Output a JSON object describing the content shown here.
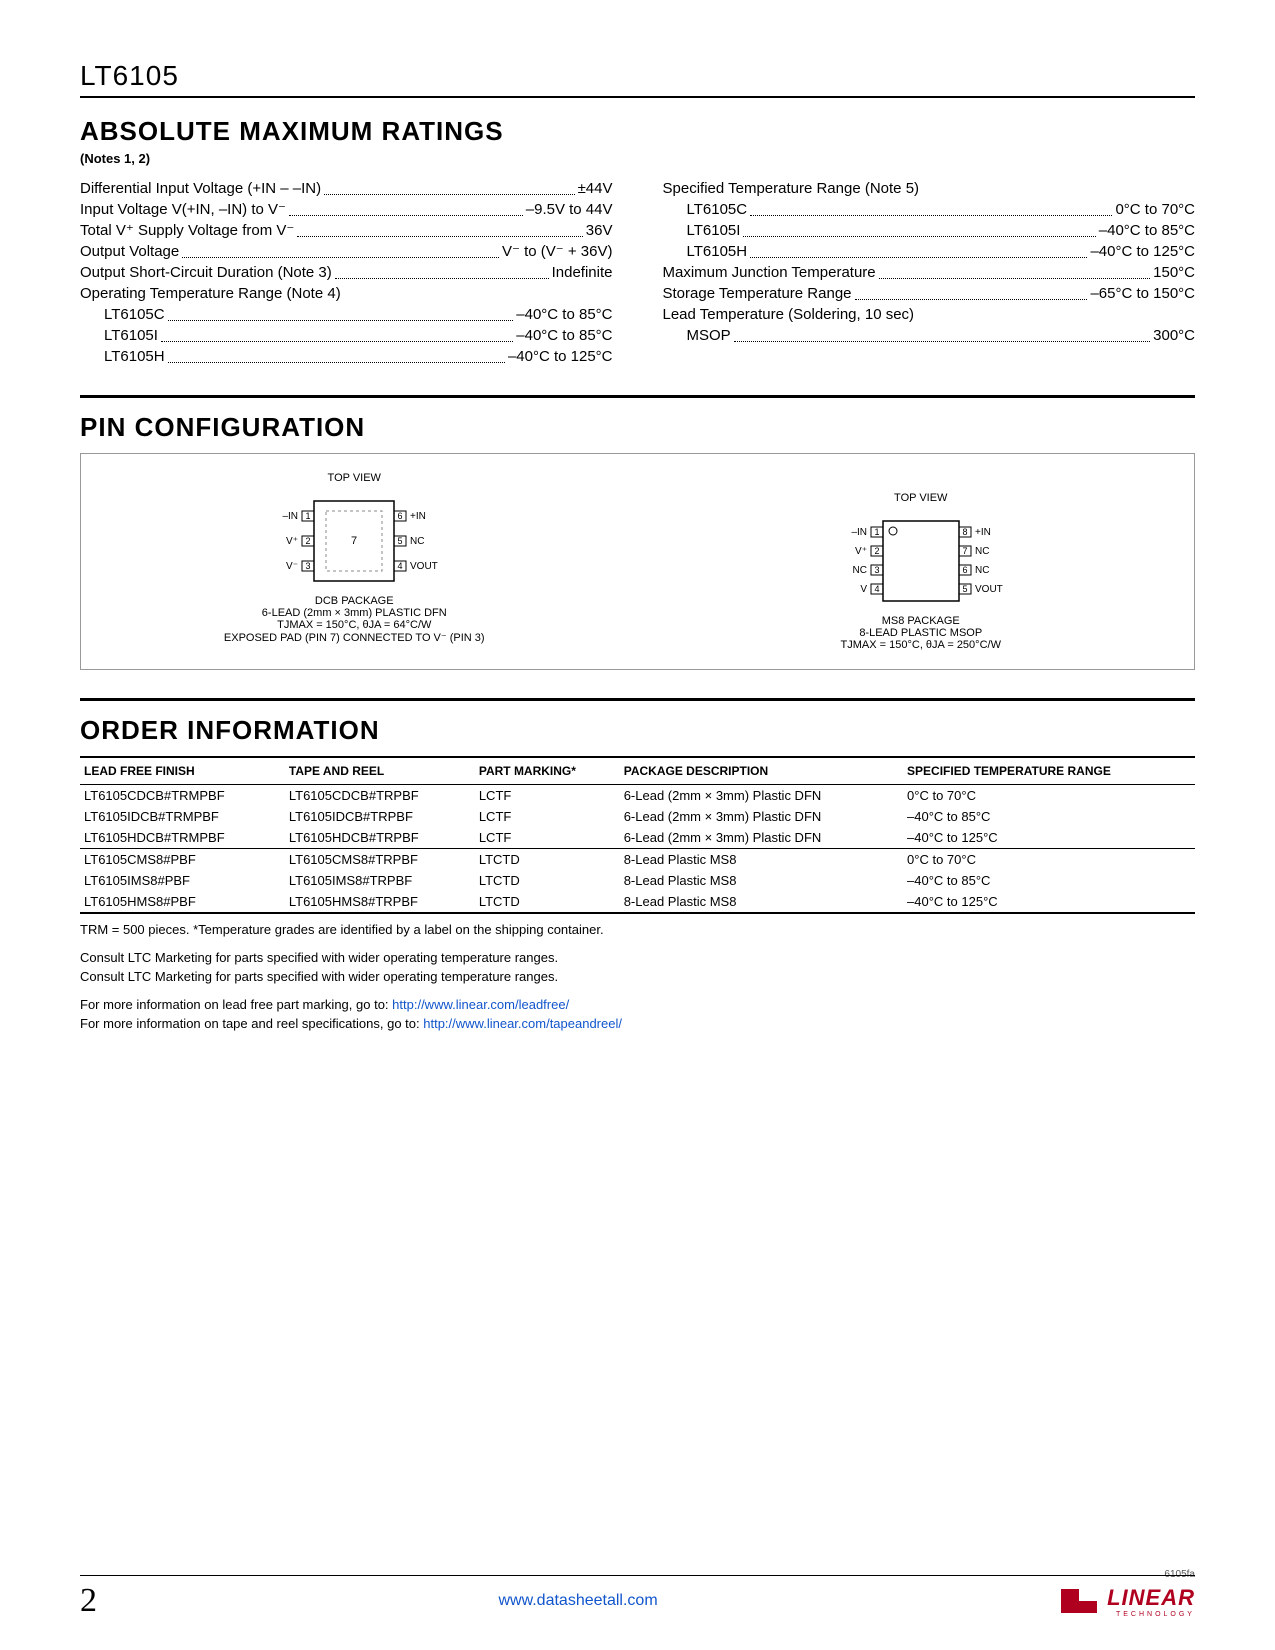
{
  "part_number": "LT6105",
  "ratings": {
    "title": "ABSOLUTE MAXIMUM RATINGS",
    "notes": "(Notes 1, 2)",
    "col1": [
      {
        "label": "Differential Input Voltage (+IN – –IN)",
        "value": "±44V"
      },
      {
        "label": "Input Voltage V(+IN, –IN) to V⁻",
        "value": "–9.5V to 44V"
      },
      {
        "label": "Total V⁺ Supply Voltage from V⁻",
        "value": "36V"
      },
      {
        "label": "Output Voltage",
        "value": "V⁻ to (V⁻ + 36V)"
      },
      {
        "label": "Output Short-Circuit Duration (Note 3)",
        "value": "Indefinite"
      },
      {
        "label": "Operating Temperature Range (Note 4)",
        "value": ""
      },
      {
        "label": "LT6105C",
        "value": "–40°C to 85°C",
        "indent": true
      },
      {
        "label": "LT6105I",
        "value": "–40°C to 85°C",
        "indent": true
      },
      {
        "label": "LT6105H",
        "value": "–40°C to 125°C",
        "indent": true
      }
    ],
    "col2": [
      {
        "label": "Specified Temperature Range (Note 5)",
        "value": ""
      },
      {
        "label": "LT6105C",
        "value": "0°C to 70°C",
        "indent": true
      },
      {
        "label": "LT6105I",
        "value": "–40°C to 85°C",
        "indent": true
      },
      {
        "label": "LT6105H",
        "value": "–40°C to 125°C",
        "indent": true
      },
      {
        "label": "Maximum Junction Temperature",
        "value": "150°C"
      },
      {
        "label": "Storage Temperature Range",
        "value": "–65°C to 150°C"
      },
      {
        "label": "Lead Temperature (Soldering, 10 sec)",
        "value": ""
      },
      {
        "label": "MSOP",
        "value": "300°C",
        "indent": true
      }
    ]
  },
  "pinconfig": {
    "title": "PIN CONFIGURATION",
    "dfn": {
      "topview": "TOP VIEW",
      "left": [
        "–IN",
        "V⁺",
        "V⁻"
      ],
      "leftnum": [
        "1",
        "2",
        "3"
      ],
      "right": [
        "+IN",
        "NC",
        "VOUT"
      ],
      "rightnum": [
        "6",
        "5",
        "4"
      ],
      "center": "7",
      "pkg1": "DCB PACKAGE",
      "pkg2": "6-LEAD (2mm × 3mm) PLASTIC DFN",
      "thermal": "TJMAX = 150°C, θJA = 64°C/W",
      "exposed": "EXPOSED PAD (PIN 7) CONNECTED TO V⁻ (PIN 3)"
    },
    "msop": {
      "topview": "TOP VIEW",
      "left": [
        "–IN",
        "V⁺",
        "NC",
        "V"
      ],
      "leftnum": [
        "1",
        "2",
        "3",
        "4"
      ],
      "right": [
        "+IN",
        "NC",
        "NC",
        "VOUT"
      ],
      "rightnum": [
        "8",
        "7",
        "6",
        "5"
      ],
      "pkg1": "MS8 PACKAGE",
      "pkg2": "8-LEAD PLASTIC MSOP",
      "thermal": "TJMAX = 150°C, θJA = 250°C/W"
    }
  },
  "order": {
    "title": "ORDER INFORMATION",
    "headers": [
      "LEAD FREE FINISH",
      "TAPE AND REEL",
      "PART MARKING*",
      "PACKAGE DESCRIPTION",
      "SPECIFIED TEMPERATURE RANGE"
    ],
    "rows": [
      [
        "LT6105CDCB#TRMPBF",
        "LT6105CDCB#TRPBF",
        "LCTF",
        "6-Lead (2mm × 3mm) Plastic DFN",
        "0°C to 70°C"
      ],
      [
        "LT6105IDCB#TRMPBF",
        "LT6105IDCB#TRPBF",
        "LCTF",
        "6-Lead (2mm × 3mm) Plastic DFN",
        "–40°C to 85°C"
      ],
      [
        "LT6105HDCB#TRMPBF",
        "LT6105HDCB#TRPBF",
        "LCTF",
        "6-Lead (2mm × 3mm) Plastic DFN",
        "–40°C to 125°C"
      ],
      [
        "LT6105CMS8#PBF",
        "LT6105CMS8#TRPBF",
        "LTCTD",
        "8-Lead Plastic MS8",
        "0°C to 70°C"
      ],
      [
        "LT6105IMS8#PBF",
        "LT6105IMS8#TRPBF",
        "LTCTD",
        "8-Lead Plastic MS8",
        "–40°C to 85°C"
      ],
      [
        "LT6105HMS8#PBF",
        "LT6105HMS8#TRPBF",
        "LTCTD",
        "8-Lead Plastic MS8",
        "–40°C to 125°C"
      ]
    ],
    "note1": "TRM = 500 pieces. *Temperature grades are identified by a label on the shipping container.",
    "note2": "Consult LTC Marketing for parts specified with wider operating temperature ranges.",
    "note3": "Consult LTC Marketing for parts specified with wider operating temperature ranges.",
    "note4a": "For more information on lead free part marking, go to: ",
    "note4b": "http://www.linear.com/leadfree/",
    "note5a": "For more information on tape and reel specifications, go to: ",
    "note5b": "http://www.linear.com/tapeandreel/"
  },
  "footer": {
    "page": "2",
    "url": "www.datasheetall.com",
    "docrev": "6105fa",
    "brand": "LINEAR",
    "brandsub": "TECHNOLOGY"
  }
}
